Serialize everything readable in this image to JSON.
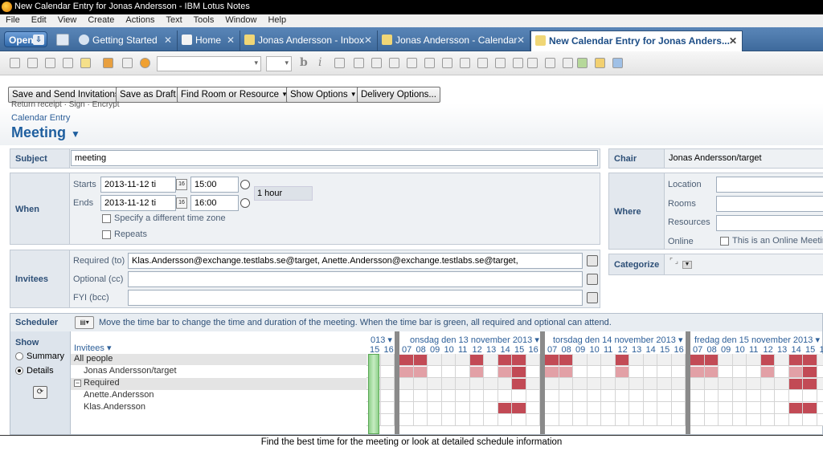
{
  "window": {
    "title": "New Calendar Entry for Jonas Andersson - IBM Lotus Notes"
  },
  "menu": [
    "File",
    "Edit",
    "View",
    "Create",
    "Actions",
    "Text",
    "Tools",
    "Window",
    "Help"
  ],
  "tabs": {
    "open": "Open",
    "items": [
      {
        "label": "Getting Started",
        "icon": "help-icon"
      },
      {
        "label": "Home",
        "icon": "home-icon"
      },
      {
        "label": "Jonas Andersson - Inbox",
        "icon": "inbox-icon"
      },
      {
        "label": "Jonas Andersson - Calendar",
        "icon": "calendar-icon"
      },
      {
        "label": "New Calendar Entry for Jonas Anders...",
        "icon": "calendar-entry-icon"
      }
    ]
  },
  "actions": {
    "save_send": "Save and Send Invitations",
    "save_draft": "Save as Draft",
    "find_room": "Find Room or Resource",
    "show_options": "Show Options",
    "delivery": "Delivery Options..."
  },
  "header": {
    "cut_text": "Return receipt  ·  Sign  ·  Encrypt",
    "type": "Calendar Entry",
    "title": "Meeting"
  },
  "subject": {
    "label": "Subject",
    "value": "meeting"
  },
  "when": {
    "label": "When",
    "starts_label": "Starts",
    "ends_label": "Ends",
    "start_date": "2013-11-12 ti",
    "start_time": "15:00",
    "end_date": "2013-11-12 ti",
    "end_time": "16:00",
    "duration": "1 hour",
    "timezone_label": "Specify a different time zone",
    "repeats_label": "Repeats"
  },
  "invitees": {
    "label": "Invitees",
    "required_label": "Required (to)",
    "required_value": "Klas.Andersson@exchange.testlabs.se@target, Anette.Andersson@exchange.testlabs.se@target,",
    "optional_label": "Optional (cc)",
    "fyi_label": "FYI (bcc)"
  },
  "chair": {
    "label": "Chair",
    "value": "Jonas Andersson/target"
  },
  "where": {
    "label": "Where",
    "location": "Location",
    "rooms": "Rooms",
    "resources": "Resources",
    "online": "Online",
    "online_cb": "This is an Online Meeting"
  },
  "categorize": {
    "label": "Categorize"
  },
  "scheduler": {
    "label": "Scheduler",
    "hint": "Move the time bar to change the time and duration of the meeting.  When the time bar is green, all required and optional can attend.",
    "show_label": "Show",
    "summary": "Summary",
    "details": "Details",
    "invitees_header": "Invitees ▾",
    "rows": [
      "All people",
      "Jonas Andersson/target",
      "Required",
      "Anette.Andersson",
      "Klas.Andersson"
    ],
    "days": [
      "013 ▾",
      "onsdag den 13 november 2013 ▾",
      "torsdag den 14 november 2013 ▾",
      "fredag den 15 november 2013 ▾"
    ],
    "hours_first": [
      "15",
      "16"
    ],
    "hours": [
      "07",
      "08",
      "09",
      "10",
      "11",
      "12",
      "13",
      "14",
      "15",
      "16"
    ]
  },
  "status": {
    "text": "Find the best time for the meeting or look at detailed schedule information"
  }
}
